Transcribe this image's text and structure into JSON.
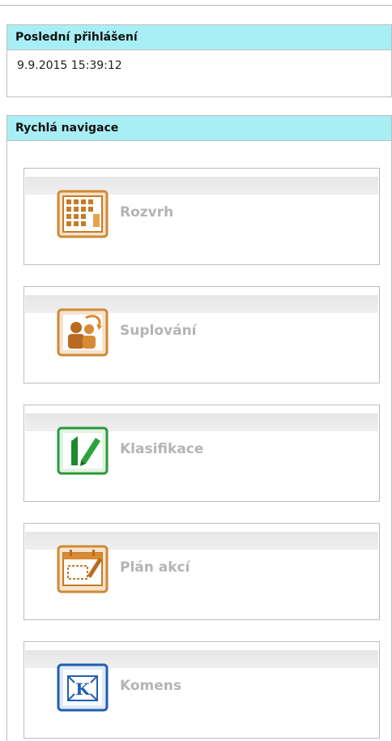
{
  "last_login": {
    "title": "Poslední přihlášení",
    "datetime": "9.9.2015 15:39:12"
  },
  "quick_nav": {
    "title": "Rychlá navigace",
    "items": [
      {
        "label": "Rozvrh",
        "icon": "timetable-icon"
      },
      {
        "label": "Suplování",
        "icon": "substitution-icon"
      },
      {
        "label": "Klasifikace",
        "icon": "grades-icon"
      },
      {
        "label": "Plán akcí",
        "icon": "event-plan-icon"
      },
      {
        "label": "Komens",
        "icon": "komens-icon"
      }
    ]
  },
  "colors": {
    "header_bg": "#a8eef5",
    "label_gray": "#b4b4b4",
    "orange": "#d98a2b",
    "green": "#2a9a3a",
    "blue": "#1f5fb0"
  }
}
